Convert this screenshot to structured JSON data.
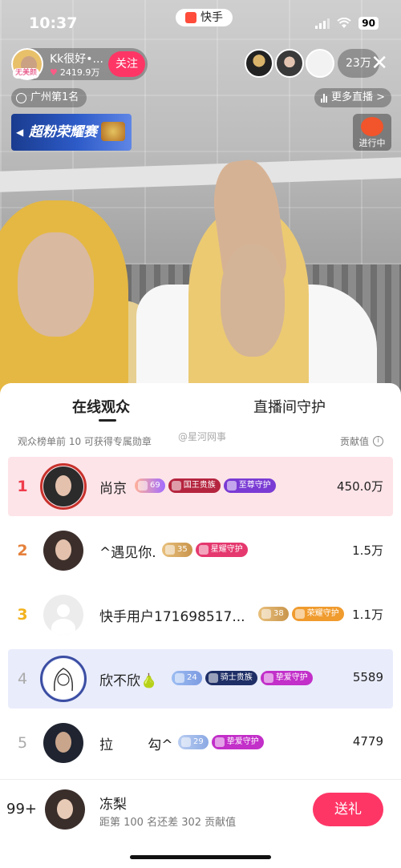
{
  "status_bar": {
    "time": "10:37",
    "app_name": "快手",
    "battery": "90"
  },
  "host": {
    "name": "Kk很好•...",
    "likes": "2419.9万",
    "badge": "无美颜",
    "follow_label": "关注"
  },
  "viewers": {
    "count": "23万"
  },
  "city_rank": "广州第1名",
  "more_live_label": "更多直播 >",
  "banner_label": "超粉荣耀赛",
  "activity_label": "进行中",
  "panel": {
    "tabs": [
      {
        "label": "在线观众"
      },
      {
        "label": "直播间守护"
      }
    ],
    "hint": "观众榜单前 10 可获得专属勋章",
    "watermark": "@星河网事",
    "contrib_label": "贡献值",
    "rows": [
      {
        "rank": "1",
        "name": "尚京",
        "level": "69",
        "badges": [
          "国王贵族",
          "至尊守护"
        ],
        "score": "450.0万"
      },
      {
        "rank": "2",
        "name": "^遇见你.",
        "level": "35",
        "badges": [
          "星耀守护"
        ],
        "score": "1.5万"
      },
      {
        "rank": "3",
        "name": "快手用户171698517...",
        "level": "38",
        "badges": [
          "荣耀守护"
        ],
        "score": "1.1万"
      },
      {
        "rank": "4",
        "name": "欣不欣🍐",
        "level": "24",
        "badges": [
          "骑士贵族",
          "挚爱守护"
        ],
        "score": "5589"
      },
      {
        "rank": "5",
        "name": "拉        勾^",
        "level": "29",
        "badges": [
          "挚爱守护"
        ],
        "score": "4779"
      }
    ]
  },
  "me": {
    "rank": "99+",
    "name": "冻梨",
    "sub": "距第 100 名还差 302 贡献值",
    "gift_label": "送礼"
  },
  "colors": {
    "accent": "#fe3666",
    "row1_bg": "#fde4e9",
    "row4_bg": "#e9ecfb"
  }
}
